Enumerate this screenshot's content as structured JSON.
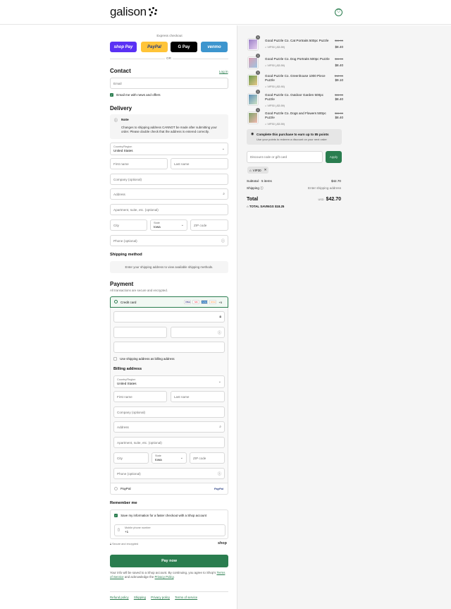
{
  "header": {
    "logo_text": "galison",
    "bag_icon": "shopping-bag-icon"
  },
  "express": {
    "label": "Express checkout",
    "shop_pay": "shop Pay",
    "paypal": "PayPal",
    "gpay": "G Pay",
    "venmo": "venmo",
    "or": "OR"
  },
  "contact": {
    "title": "Contact",
    "login": "Log in",
    "email_placeholder": "Email",
    "news_label": "Email me with news and offers"
  },
  "delivery": {
    "title": "Delivery",
    "note_title": "Note",
    "note_text": "Changes to shipping address CANNOT be made after submitting your order. Please double check that the address is entered correctly.",
    "country_label": "Country/Region",
    "country_value": "United States",
    "first_name": "First name",
    "last_name": "Last name",
    "company": "Company (optional)",
    "address": "Address",
    "apartment": "Apartment, suite, etc. (optional)",
    "city": "City",
    "state_label": "State",
    "state_value": "Iowa",
    "zip": "ZIP code",
    "phone": "Phone (optional)"
  },
  "shipping_method": {
    "title": "Shipping method",
    "placeholder": "Enter your shipping address to view available shipping methods."
  },
  "payment": {
    "title": "Payment",
    "subtitle": "All transactions are secure and encrypted.",
    "credit_card": "Credit card",
    "card_brands": [
      "VISA",
      "MC",
      "AMEX",
      "DISC"
    ],
    "more": "+5",
    "use_shipping": "Use shipping address as billing address",
    "billing_title": "Billing address",
    "paypal": "PayPal"
  },
  "billing": {
    "country_label": "Country/Region",
    "country_value": "United States",
    "first_name": "First name",
    "last_name": "Last name",
    "company": "Company (optional)",
    "address": "Address",
    "apartment": "Apartment, suite, etc. (optional)",
    "city": "City",
    "state_label": "State",
    "state_value": "Iowa",
    "zip": "ZIP code",
    "phone": "Phone (optional)"
  },
  "remember": {
    "title": "Remember me",
    "save_label": "Save my information for a faster checkout with a Shop account",
    "mobile_label": "Mobile phone number",
    "mobile_prefix": "+1",
    "secure": "Secure and encrypted",
    "shop": "shop"
  },
  "pay_now": "Pay now",
  "legal": {
    "text1": "Your info will be saved to a Shop account. By continuing, you agree to Shop's",
    "terms": "Terms of Service",
    "text2": "and acknowledge the",
    "privacy": "Privacy Policy",
    "period": "."
  },
  "footer": {
    "links": [
      "Refund policy",
      "Shipping",
      "Privacy policy",
      "Terms of service"
    ]
  },
  "cart": {
    "items": [
      {
        "title": "Good Puzzle Co. Cat Portraits 500pc Puzzle",
        "discount": "VIP30 (-$3.59)",
        "old": "$11.99",
        "new": "$8.40",
        "qty": "1",
        "color": "#9b7fc7"
      },
      {
        "title": "Good Puzzle Co. Dog Portraits 500pc Puzzle",
        "discount": "VIP30 (-$3.59)",
        "old": "$11.99",
        "new": "$8.40",
        "qty": "1",
        "color": "#d9a0b4"
      },
      {
        "title": "Good Puzzle Co. Greenhouse 1000 Piece Puzzle",
        "discount": "VIP30 (-$3.90)",
        "old": "$12.99",
        "new": "$9.10",
        "qty": "1",
        "color": "#6a9a4f"
      },
      {
        "title": "Good Puzzle Co. Outdoor Garden 500pc Puzzle",
        "discount": "VIP30 (-$3.59)",
        "old": "$11.99",
        "new": "$8.40",
        "qty": "1",
        "color": "#5d8fb8"
      },
      {
        "title": "Good Puzzle Co. Dogs and Flowers 500pc Puzzle",
        "discount": "VIP30 (-$3.59)",
        "old": "$11.99",
        "new": "$8.40",
        "qty": "1",
        "color": "#7fa36a"
      }
    ],
    "points_title": "Complete this purchase to earn up to 85 points",
    "points_sub": "Use your points to redeem a discount on your next order",
    "discount_placeholder": "Discount code or gift card",
    "apply": "Apply",
    "tag": "VIP30",
    "subtotal_label": "Subtotal · 5 items",
    "subtotal_value": "$42.70",
    "shipping_label": "Shipping",
    "shipping_value": "Enter shipping address",
    "total_label": "Total",
    "currency": "USD",
    "total_value": "$42.70",
    "savings_label": "TOTAL SAVINGS",
    "savings_value": "$18.25"
  },
  "colors": {
    "accent": "#2a7d4f",
    "shop_pay": "#5a31f4",
    "paypal": "#ffc439",
    "venmo": "#3d95ce"
  }
}
